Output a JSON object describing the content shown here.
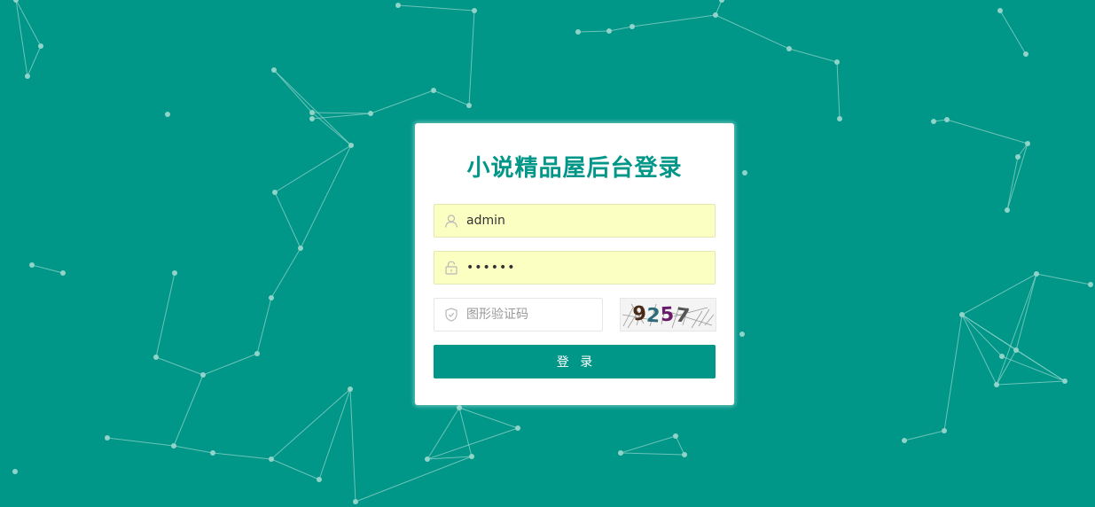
{
  "login": {
    "title": "小说精品屋后台登录",
    "username": {
      "value": "admin",
      "icon": "user-icon"
    },
    "password": {
      "value": "••••••",
      "icon": "lock-icon"
    },
    "captcha": {
      "placeholder": "图形验证码",
      "icon": "shield-check-icon",
      "image_text": "9257"
    },
    "submit_label": "登 录"
  },
  "theme": {
    "background": "#009688",
    "accent": "#009688",
    "autofill_background": "#fbffc2",
    "particle_color": "#8fd3c9"
  }
}
